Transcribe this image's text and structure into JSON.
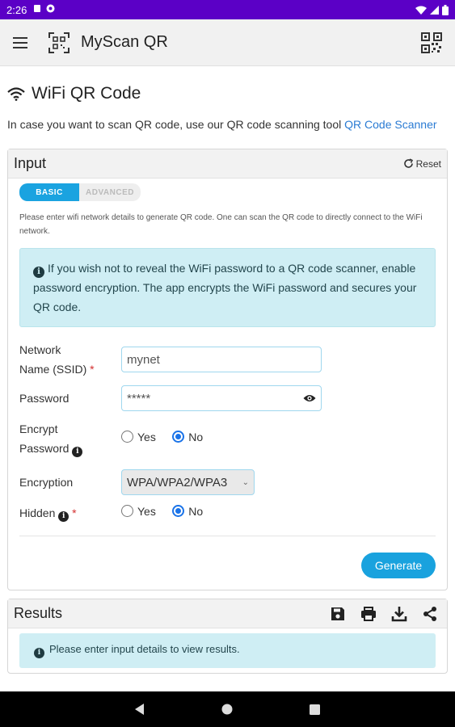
{
  "status_bar": {
    "time": "2:26"
  },
  "app_bar": {
    "title": "MyScan QR"
  },
  "page": {
    "title": "WiFi QR Code",
    "intro_text": "In case you want to scan QR code, use our QR code scanning tool ",
    "intro_link": "QR Code Scanner"
  },
  "input_card": {
    "header": "Input",
    "reset_label": "Reset",
    "tabs": [
      {
        "label": "BASIC",
        "active": true
      },
      {
        "label": "ADVANCED",
        "active": false
      }
    ],
    "hint": "Please enter wifi network details to generate QR code. One can scan the QR code to directly connect to the WiFi network.",
    "info_alert": "If you wish not to reveal the WiFi password to a QR code scanner, enable password encryption. The app encrypts the WiFi password and secures your QR code.",
    "fields": {
      "ssid": {
        "label_line1": "Network",
        "label_line2": "Name (SSID)",
        "value": "mynet"
      },
      "password": {
        "label": "Password",
        "value": "*****"
      },
      "encrypt": {
        "label_line1": "Encrypt",
        "label_line2": "Password",
        "yes": "Yes",
        "no": "No",
        "selected": "No"
      },
      "encryption": {
        "label": "Encryption",
        "value": "WPA/WPA2/WPA3"
      },
      "hidden": {
        "label": "Hidden",
        "yes": "Yes",
        "no": "No",
        "selected": "No"
      }
    },
    "generate_label": "Generate"
  },
  "results_card": {
    "header": "Results",
    "info_alert": "Please enter input details to view results."
  },
  "colors": {
    "status_bar": "#5b00c6",
    "accent": "#19a2de",
    "info_bg": "#cfeef4",
    "link": "#2a7bd3"
  },
  "icons": [
    "menu-icon",
    "qr-logo-icon",
    "qr-code-icon",
    "wifi-icon",
    "reset-icon",
    "info-icon",
    "eye-icon",
    "save-icon",
    "print-icon",
    "download-icon",
    "share-icon"
  ]
}
